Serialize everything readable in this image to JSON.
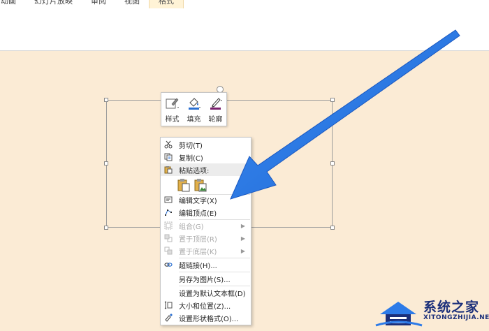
{
  "ribbon": {
    "tabs": [
      {
        "label": "动画",
        "active": false
      },
      {
        "label": "幻灯片放映",
        "active": false
      },
      {
        "label": "审阅",
        "active": false
      },
      {
        "label": "视图",
        "active": false
      },
      {
        "label": "格式",
        "active": true
      }
    ]
  },
  "mini_toolbar": {
    "buttons": [
      {
        "label": "样式",
        "icon": "style-icon"
      },
      {
        "label": "填充",
        "icon": "fill-bucket-icon"
      },
      {
        "label": "轮廓",
        "icon": "outline-pen-icon"
      }
    ]
  },
  "context_menu": {
    "items": [
      {
        "label": "剪切(T)",
        "icon": "scissors-icon",
        "disabled": false
      },
      {
        "label": "复制(C)",
        "icon": "copy-icon",
        "disabled": false
      },
      {
        "label": "粘贴选项:",
        "icon": "paste-icon",
        "disabled": false,
        "header": true
      },
      {
        "label": "编辑文字(X)",
        "icon": "edit-text-icon",
        "disabled": false
      },
      {
        "label": "编辑顶点(E)",
        "icon": "edit-points-icon",
        "disabled": false
      },
      {
        "label": "组合(G)",
        "icon": "group-icon",
        "disabled": true,
        "submenu": true
      },
      {
        "label": "置于顶层(R)",
        "icon": "bring-front-icon",
        "disabled": true,
        "submenu": true
      },
      {
        "label": "置于底层(K)",
        "icon": "send-back-icon",
        "disabled": true,
        "submenu": true
      },
      {
        "label": "超链接(H)...",
        "icon": "hyperlink-icon",
        "disabled": false
      },
      {
        "label": "另存为图片(S)...",
        "icon": "",
        "disabled": false
      },
      {
        "label": "设置为默认文本框(D)",
        "icon": "",
        "disabled": false
      },
      {
        "label": "大小和位置(Z)...",
        "icon": "size-position-icon",
        "disabled": false
      },
      {
        "label": "设置形状格式(O)...",
        "icon": "format-shape-icon",
        "disabled": false
      }
    ]
  },
  "watermark": {
    "name_cn": "系统之家",
    "name_en": "XITONGZHIJIA.NET"
  },
  "colors": {
    "slide_bg": "#fbebd5",
    "arrow": "#2d7be8",
    "watermark": "#1b2f7a"
  }
}
